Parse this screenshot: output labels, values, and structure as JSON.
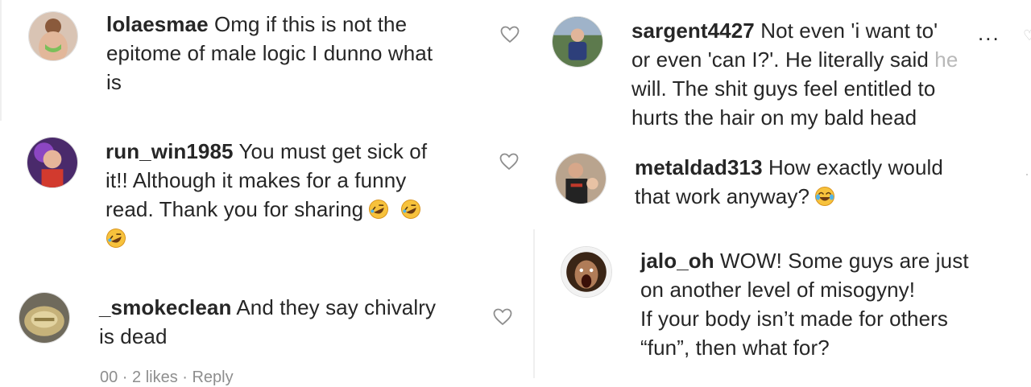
{
  "left_column": {
    "comments": [
      {
        "username": "lolaesmae",
        "lines": [
          " Omg if this is not the",
          "epitome of male logic I dunno what",
          "is"
        ]
      },
      {
        "username": "run_win1985",
        "lines": [
          " You must get sick of",
          "it!! Although it makes for a funny",
          "read. Thank you for sharing"
        ],
        "emoji": "rolling-on-floor-laughing-emoji"
      },
      {
        "username": "_smokeclean",
        "lines": [
          " And they say chivalry",
          "is dead"
        ]
      }
    ],
    "cutoff_meta": "00  ·  2 likes  ·  Reply"
  },
  "right_column": {
    "comments": [
      {
        "username": "sargent4427",
        "lines": [
          " Not even 'i want to'",
          "or even 'can I?'. He literally said ",
          "will. The shit guys feel entitled to",
          "hurts the hair on my bald head"
        ],
        "faded": "he",
        "more_label": "..."
      },
      {
        "username": "metaldad313",
        "lines": [
          " How exactly would",
          "that work anyway?"
        ],
        "emoji": "face-with-tears-of-joy-emoji"
      },
      {
        "username": "jalo_oh",
        "lines": [
          " WOW! Some guys are just",
          "on another level of misogyny!",
          "If your body isn’t made for others",
          "“fun”, then what for?"
        ]
      }
    ]
  },
  "colors": {
    "text": "#262626",
    "icon_stroke": "#8e8e8e",
    "divider": "#efefef",
    "emoji_yellow": "#f7c23c"
  }
}
